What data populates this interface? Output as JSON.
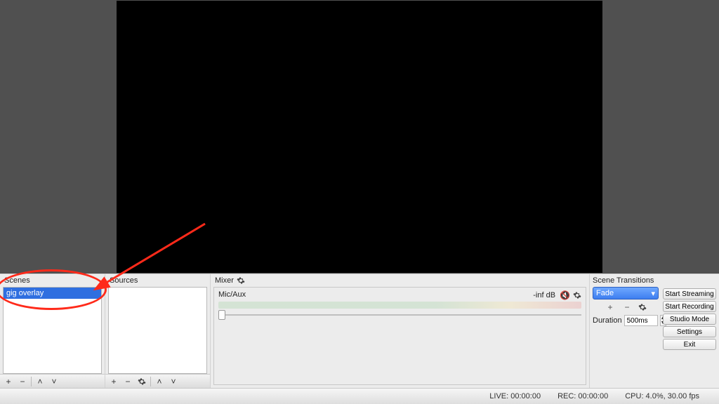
{
  "panels": {
    "scenes": {
      "title": "Scenes",
      "items": [
        "gig overlay"
      ],
      "selected": 0
    },
    "sources": {
      "title": "Sources",
      "items": []
    },
    "mixer": {
      "title": "Mixer",
      "channel": {
        "name": "Mic/Aux",
        "level": "-inf dB"
      }
    },
    "transitions": {
      "title": "Scene Transitions",
      "selected": "Fade",
      "duration_label": "Duration",
      "duration_value": "500ms"
    }
  },
  "controls": {
    "buttons": [
      "Start Streaming",
      "Start Recording",
      "Studio Mode",
      "Settings",
      "Exit"
    ]
  },
  "statusbar": {
    "live": "LIVE: 00:00:00",
    "rec": "REC: 00:00:00",
    "cpu": "CPU: 4.0%, 30.00 fps"
  },
  "icons": {
    "plus": "+",
    "minus": "−",
    "up": "˄",
    "down": "˅",
    "gear": "gear"
  }
}
